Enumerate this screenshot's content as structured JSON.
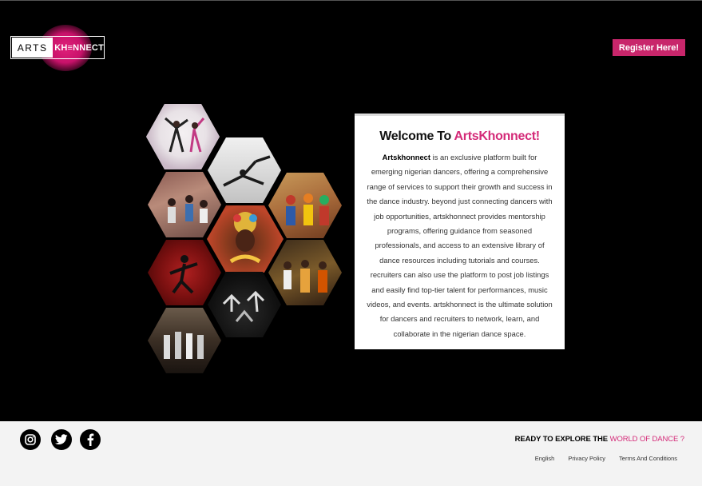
{
  "header": {
    "logo": {
      "arts": "ARTS",
      "khonnect": "KH≡NNECT"
    },
    "register_label": "Register Here!"
  },
  "gallery": {
    "images": [
      "dancers-leaping-photo",
      "dancer-acrobatic-pose-photo",
      "street-dance-crew-photo",
      "cultural-dance-troupe-photo",
      "masquerade-dancer-portrait-photo",
      "dancers-in-red-light-photo",
      "traditional-dancers-group-photo",
      "stage-dancers-jumping-photo",
      "dance-crew-stage-photo"
    ]
  },
  "welcome": {
    "title_prefix": "Welcome To ",
    "title_brand": "ArtsKhonnect!",
    "body_brand": "Artskhonnect",
    "body_text": " is an exclusive platform built for emerging nigerian dancers, offering a comprehensive range of services to support their growth and success in the dance industry. beyond just connecting dancers with job opportunities, artskhonnect provides mentorship programs, offering guidance from seasoned professionals, and access to an extensive library of dance resources including tutorials and courses. recruiters can also use the platform to post job listings and easily find top-tier talent for performances, music videos, and events. artskhonnect is the ultimate solution for dancers and recruiters to network, learn, and collaborate in the nigerian dance space."
  },
  "footer": {
    "social": [
      "instagram-icon",
      "twitter-icon",
      "facebook-icon"
    ],
    "explore_prefix": "READY TO EXPLORE THE ",
    "explore_highlight": "WORLD OF DANCE ?",
    "links": [
      "English",
      "Privacy Policy",
      "Terms And Conditions"
    ]
  },
  "colors": {
    "accent": "#d42a78",
    "background": "#000000",
    "footer_bg": "#f3f3f3"
  }
}
